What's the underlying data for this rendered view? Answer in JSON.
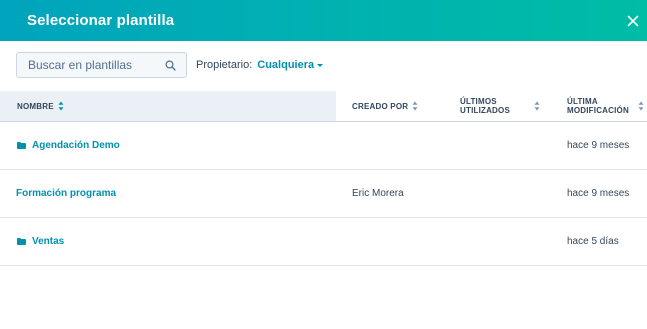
{
  "modal": {
    "title": "Seleccionar plantilla",
    "close_icon": "close-icon"
  },
  "toolbar": {
    "search_placeholder": "Buscar en plantillas",
    "search_value": "",
    "owner_label": "Propietario:",
    "owner_value": "Cualquiera"
  },
  "table": {
    "columns": {
      "name": "NOMBRE",
      "created_by": "CREADO POR",
      "last_used_1": "ÚLTIMOS",
      "last_used_2": "UTILIZADOS",
      "last_modified_1": "ÚLTIMA",
      "last_modified_2": "MODIFICACIÓN"
    },
    "rows": [
      {
        "name": "Agendación Demo",
        "is_folder": true,
        "created_by": "",
        "last_used": "",
        "last_modified": "hace 9 meses"
      },
      {
        "name": "Formación programa",
        "is_folder": false,
        "created_by": "Eric Morera",
        "last_used": "",
        "last_modified": "hace 9 meses"
      },
      {
        "name": "Ventas",
        "is_folder": true,
        "created_by": "",
        "last_used": "",
        "last_modified": "hace 5 días"
      }
    ]
  },
  "colors": {
    "header_gradient_start": "#00a4bd",
    "header_gradient_end": "#00bda5",
    "link": "#0091ae",
    "text": "#33475b"
  }
}
